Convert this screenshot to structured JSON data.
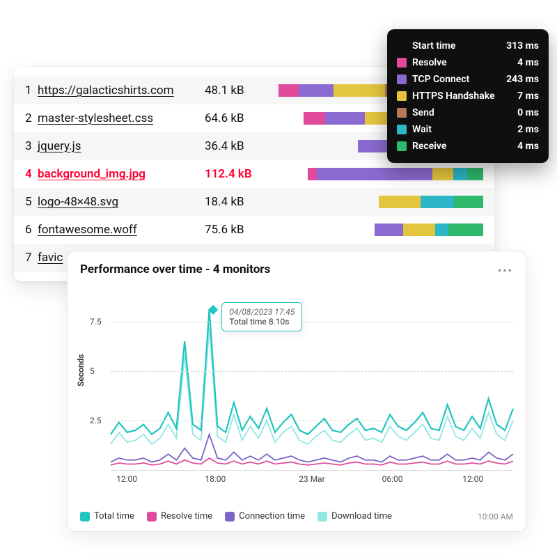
{
  "colors": {
    "resolve": "#e14a9b",
    "tcp": "#8a6ad0",
    "https": "#e4c63e",
    "send": "#b87a55",
    "wait": "#2bb7c8",
    "receive": "#2fb96c",
    "highlight": "#ff0030",
    "totalLine": "#1fc5c0",
    "downloadLine": "#8fe7e3",
    "connectLine": "#7c63c7",
    "resolveLine": "#e14a9b"
  },
  "waterfall": {
    "rows": [
      {
        "idx": "1",
        "name": "https://galacticshirts.com",
        "size": "48.1 kB",
        "highlight": false,
        "bar": {
          "left": 2,
          "segments": [
            {
              "colorKey": "resolve",
              "pct": 10
            },
            {
              "colorKey": "tcp",
              "pct": 17
            },
            {
              "colorKey": "https",
              "pct": 25
            },
            {
              "colorKey": "send",
              "pct": 6
            },
            {
              "colorKey": "wait",
              "pct": 16
            },
            {
              "colorKey": "receive",
              "pct": 26
            }
          ]
        }
      },
      {
        "idx": "2",
        "name": "master-stylesheet.css",
        "size": "64.6 kB",
        "highlight": false,
        "bar": {
          "left": 14,
          "segments": [
            {
              "colorKey": "resolve",
              "pct": 12
            },
            {
              "colorKey": "tcp",
              "pct": 22
            },
            {
              "colorKey": "https",
              "pct": 14
            },
            {
              "colorKey": "wait",
              "pct": 22
            },
            {
              "colorKey": "receive",
              "pct": 30
            }
          ]
        }
      },
      {
        "idx": "3",
        "name": "jquery.js",
        "size": "36.4 kB",
        "highlight": false,
        "bar": {
          "left": 40,
          "segments": [
            {
              "colorKey": "tcp",
              "pct": 26
            },
            {
              "colorKey": "https",
              "pct": 32
            },
            {
              "colorKey": "wait",
              "pct": 18
            },
            {
              "colorKey": "receive",
              "pct": 24
            }
          ]
        }
      },
      {
        "idx": "4",
        "name": "background_img.jpg",
        "size": "112.4 kB",
        "highlight": true,
        "bar": {
          "left": 16,
          "segments": [
            {
              "colorKey": "resolve",
              "pct": 5
            },
            {
              "colorKey": "tcp",
              "pct": 66
            },
            {
              "colorKey": "https",
              "pct": 12
            },
            {
              "colorKey": "wait",
              "pct": 8
            },
            {
              "colorKey": "receive",
              "pct": 9
            }
          ]
        }
      },
      {
        "idx": "5",
        "name": "logo-48×48.svg",
        "size": "18.4 kB",
        "highlight": false,
        "bar": {
          "left": 50,
          "segments": [
            {
              "colorKey": "https",
              "pct": 40
            },
            {
              "colorKey": "wait",
              "pct": 32
            },
            {
              "colorKey": "receive",
              "pct": 28
            }
          ]
        }
      },
      {
        "idx": "6",
        "name": "fontawesome.woff",
        "size": "75.6 kB",
        "highlight": false,
        "bar": {
          "left": 48,
          "segments": [
            {
              "colorKey": "tcp",
              "pct": 26
            },
            {
              "colorKey": "https",
              "pct": 30
            },
            {
              "colorKey": "wait",
              "pct": 12
            },
            {
              "colorKey": "receive",
              "pct": 32
            }
          ]
        }
      },
      {
        "idx": "7",
        "name": "favic",
        "size": "",
        "highlight": false,
        "bar": {
          "left": 0,
          "segments": []
        }
      }
    ]
  },
  "tooltip": {
    "header": {
      "label": "Start time",
      "value": "313 ms"
    },
    "rows": [
      {
        "colorKey": "resolve",
        "label": "Resolve",
        "value": "4 ms"
      },
      {
        "colorKey": "tcp",
        "label": "TCP Connect",
        "value": "243 ms"
      },
      {
        "colorKey": "https",
        "label": "HTTPS Handshake",
        "value": "7 ms"
      },
      {
        "colorKey": "send",
        "label": "Send",
        "value": "0 ms"
      },
      {
        "colorKey": "wait",
        "label": "Wait",
        "value": "2 ms"
      },
      {
        "colorKey": "receive",
        "label": "Receive",
        "value": "4 ms"
      }
    ]
  },
  "chart": {
    "title": "Performance over time - 4 monitors",
    "ylabel": "Seconds",
    "yticks": [
      "2.5",
      "5",
      "7.5"
    ],
    "xticks": [
      {
        "label": "12:00",
        "pos": 0.04
      },
      {
        "label": "18:00",
        "pos": 0.26
      },
      {
        "label": "23 Mar",
        "pos": 0.5
      },
      {
        "label": "06:00",
        "pos": 0.7
      },
      {
        "label": "12:00",
        "pos": 0.9
      }
    ],
    "legend": [
      {
        "colorKey": "totalLine",
        "label": "Total time"
      },
      {
        "colorKey": "resolveLine",
        "label": "Resolve time"
      },
      {
        "colorKey": "connectLine",
        "label": "Connection time"
      },
      {
        "colorKey": "downloadLine",
        "label": "Download time"
      }
    ],
    "timestamp": "10:00 AM",
    "hover": {
      "xPct": 0.255,
      "time": "04/08/2023 17:45",
      "value": "Total time 8.10s"
    }
  },
  "chart_data": {
    "type": "line",
    "title": "Performance over time - 4 monitors",
    "xlabel": "",
    "ylabel": "Seconds",
    "ylim": [
      0,
      9
    ],
    "xticks": [
      "12:00",
      "18:00",
      "23 Mar",
      "06:00",
      "12:00"
    ],
    "x": [
      0,
      1,
      2,
      3,
      4,
      5,
      6,
      7,
      8,
      9,
      10,
      11,
      12,
      13,
      14,
      15,
      16,
      17,
      18,
      19,
      20,
      21,
      22,
      23,
      24,
      25,
      26,
      27,
      28,
      29,
      30,
      31,
      32,
      33,
      34,
      35,
      36,
      37,
      38,
      39,
      40,
      41,
      42,
      43,
      44,
      45,
      46,
      47,
      48,
      49
    ],
    "series": [
      {
        "name": "Total time",
        "colorKey": "totalLine",
        "values": [
          1.8,
          2.4,
          1.9,
          2.0,
          2.3,
          1.8,
          2.1,
          2.9,
          2.1,
          6.5,
          2.3,
          2.0,
          8.1,
          2.2,
          1.9,
          3.4,
          2.0,
          2.7,
          2.1,
          3.1,
          1.9,
          2.4,
          2.8,
          2.0,
          1.8,
          2.2,
          2.6,
          2.0,
          1.9,
          2.3,
          2.6,
          2.0,
          2.1,
          1.9,
          2.8,
          2.2,
          2.0,
          2.4,
          2.9,
          2.1,
          2.0,
          3.3,
          2.2,
          2.0,
          2.7,
          2.1,
          3.6,
          2.3,
          2.0,
          3.1
        ]
      },
      {
        "name": "Download time",
        "colorKey": "downloadLine",
        "values": [
          1.3,
          1.9,
          1.4,
          1.5,
          1.8,
          1.3,
          1.6,
          2.3,
          1.6,
          5.8,
          1.8,
          1.5,
          7.2,
          1.7,
          1.4,
          2.8,
          1.5,
          2.2,
          1.6,
          2.5,
          1.4,
          1.9,
          2.2,
          1.5,
          1.3,
          1.7,
          2.0,
          1.5,
          1.4,
          1.8,
          2.1,
          1.5,
          1.6,
          1.4,
          2.2,
          1.7,
          1.5,
          1.9,
          2.3,
          1.6,
          1.5,
          2.7,
          1.7,
          1.5,
          2.1,
          1.6,
          2.9,
          1.8,
          1.5,
          2.5
        ]
      },
      {
        "name": "Connection time",
        "colorKey": "connectLine",
        "values": [
          0.4,
          0.6,
          0.5,
          0.5,
          0.6,
          0.4,
          0.5,
          0.8,
          0.5,
          1.1,
          0.6,
          0.5,
          1.8,
          0.6,
          0.5,
          0.9,
          0.5,
          0.7,
          0.5,
          0.8,
          0.5,
          0.6,
          0.7,
          0.5,
          0.4,
          0.5,
          0.6,
          0.5,
          0.4,
          0.6,
          0.7,
          0.5,
          0.5,
          0.4,
          0.7,
          0.5,
          0.5,
          0.6,
          0.7,
          0.5,
          0.5,
          0.8,
          0.5,
          0.5,
          0.6,
          0.5,
          0.9,
          0.6,
          0.5,
          0.8
        ]
      },
      {
        "name": "Resolve time",
        "colorKey": "resolveLine",
        "values": [
          0.25,
          0.35,
          0.3,
          0.3,
          0.35,
          0.25,
          0.3,
          0.45,
          0.3,
          0.5,
          0.35,
          0.3,
          0.6,
          0.35,
          0.3,
          0.45,
          0.3,
          0.4,
          0.3,
          0.45,
          0.3,
          0.35,
          0.4,
          0.3,
          0.25,
          0.3,
          0.35,
          0.3,
          0.25,
          0.35,
          0.4,
          0.3,
          0.3,
          0.25,
          0.4,
          0.3,
          0.3,
          0.35,
          0.4,
          0.3,
          0.3,
          0.45,
          0.3,
          0.3,
          0.35,
          0.3,
          0.45,
          0.35,
          0.3,
          0.45
        ]
      }
    ],
    "annotations": [
      {
        "x": 12,
        "label": "04/08/2023 17:45",
        "text": "Total time 8.10s"
      }
    ]
  }
}
